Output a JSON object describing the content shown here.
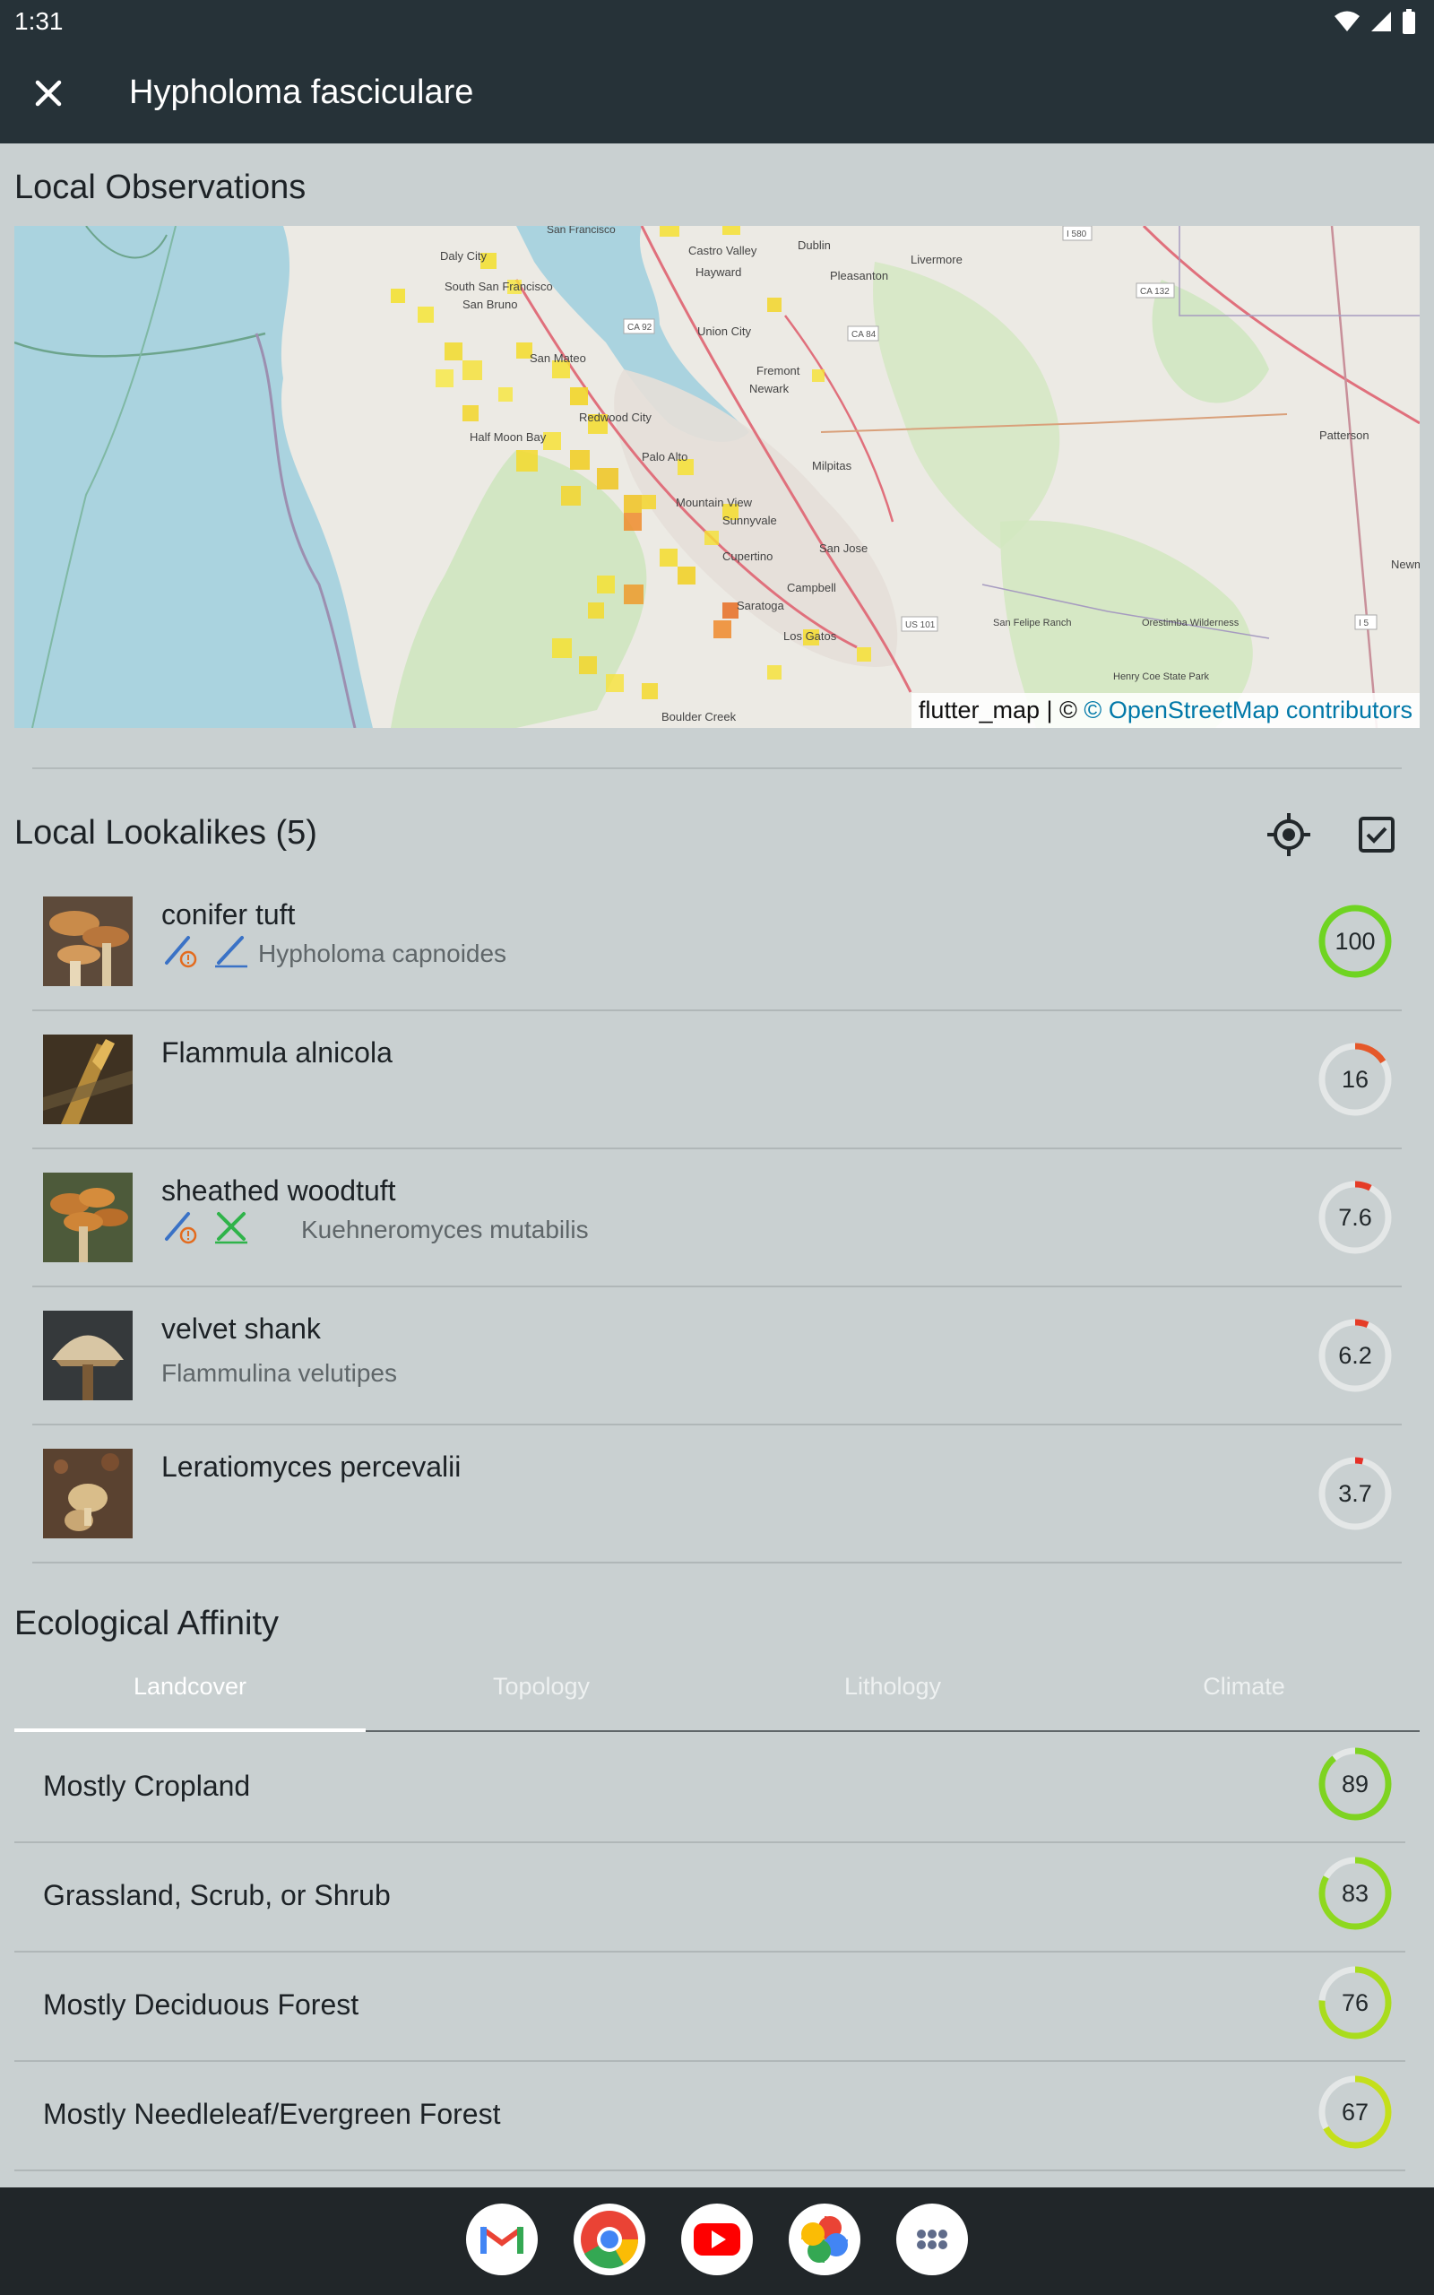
{
  "status_bar": {
    "time": "1:31"
  },
  "app_bar": {
    "title": "Hypholoma fasciculare"
  },
  "observations": {
    "title": "Local Observations",
    "attribution_prefix": "flutter_map | ©",
    "attribution_link": "© OpenStreetMap contributors",
    "place_labels": [
      "Daly City",
      "South San Francisco",
      "San Bruno",
      "San Mateo",
      "Redwood City",
      "Half Moon Bay",
      "Palo Alto",
      "Mountain View",
      "Sunnyvale",
      "Cupertino",
      "Saratoga",
      "Campbell",
      "San Jose",
      "Los Gatos",
      "Milpitas",
      "Fremont",
      "Union City",
      "Hayward",
      "Castro Valley",
      "Dublin",
      "Pleasanton",
      "Livermore",
      "Newark",
      "Boulder Creek",
      "San Felipe Ranch",
      "Henry Coe State Park",
      "Orestimba Wilderness",
      "Patterson",
      "Newman",
      "San Francisco"
    ],
    "road_labels": [
      "I 580",
      "CA 92",
      "CA 84",
      "CA 132",
      "US 101",
      "I 5"
    ]
  },
  "lookalikes": {
    "title": "Local Lookalikes (5)",
    "items": [
      {
        "name": "conifer tuft",
        "scientific": "Hypholoma capnoides",
        "score": "100",
        "value": 100,
        "color": "#6fd422",
        "badges": [
          "knife-warning-icon",
          "knife-icon"
        ]
      },
      {
        "name": "Flammula alnicola",
        "scientific": "",
        "score": "16",
        "value": 16,
        "color": "#e5582a",
        "badges": []
      },
      {
        "name": "sheathed woodtuft",
        "scientific": "Kuehneromyces mutabilis",
        "score": "7.6",
        "value": 7.6,
        "color": "#e53c27",
        "badges": [
          "knife-warning-icon",
          "crossed-utensils-icon"
        ]
      },
      {
        "name": "velvet shank",
        "scientific": "Flammulina velutipes",
        "score": "6.2",
        "value": 6.2,
        "color": "#e53c27",
        "badges": []
      },
      {
        "name": "Leratiomyces percevalii",
        "scientific": "",
        "score": "3.7",
        "value": 3.7,
        "color": "#e53027",
        "badges": []
      }
    ]
  },
  "ecology": {
    "title": "Ecological Affinity",
    "tabs": [
      "Landcover",
      "Topology",
      "Lithology",
      "Climate"
    ],
    "active_tab": "Landcover",
    "items": [
      {
        "label": "Mostly Cropland",
        "score": "89",
        "value": 89,
        "color": "#7ed321"
      },
      {
        "label": "Grassland, Scrub, or Shrub",
        "score": "83",
        "value": 83,
        "color": "#8ed81f"
      },
      {
        "label": "Mostly Deciduous Forest",
        "score": "76",
        "value": 76,
        "color": "#a9dc1d"
      },
      {
        "label": "Mostly Needleleaf/Evergreen Forest",
        "score": "67",
        "value": 67,
        "color": "#c4df1b"
      }
    ]
  },
  "dock": {
    "apps": [
      "gmail-icon",
      "chrome-icon",
      "youtube-icon",
      "photos-icon",
      "app-drawer-icon"
    ]
  }
}
